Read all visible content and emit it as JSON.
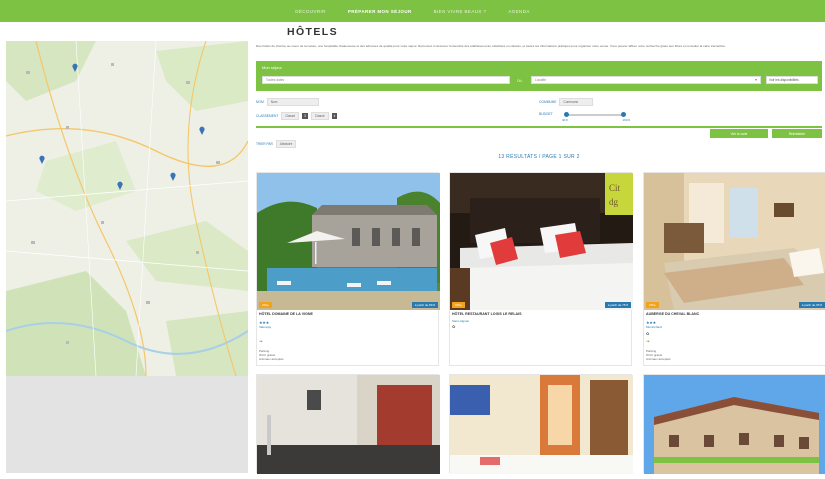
{
  "nav": {
    "items": [
      {
        "label": "DÉCOUVRIR",
        "active": false
      },
      {
        "label": "PRÉPARER MON SÉJOUR",
        "active": true
      },
      {
        "label": "BIEN VIVRE BEAUX ?",
        "active": false
      },
      {
        "label": "AGENDA",
        "active": false
      }
    ]
  },
  "page": {
    "title": "HÔTELS",
    "intro": "Des hôtels de charme au coeur de la nature, une hospitalité chaleureuse et des adresses de qualité pour votre séjour. Retrouvez ci-dessous l'ensemble des établissements, labellisés ou classés, et toutes les informations pratiques pour organiser votre venue. Vous pouvez affiner votre recherche grâce aux filtres et consulter la carte interactive."
  },
  "search": {
    "label": "Mon séjour",
    "input_value": "Toutes dates",
    "select_label": "Où",
    "select_value": "Localité",
    "button_label": "Voir les disponibilités"
  },
  "filters": {
    "nom_label": "NOM",
    "nom_value": "Nom",
    "classement_label": "CLASSEMENT",
    "classement_a": "Classé",
    "classement_a_count": "3",
    "classement_b": "Classé",
    "classement_b_count": "4",
    "commune_label": "COMMUNE",
    "commune_value": "Commune",
    "budget_label": "BUDGET",
    "budget_min": "40 €",
    "budget_max": "190 €",
    "reset_label": "Réinitialiser",
    "map_label": "Voir la carte",
    "tri_label": "TRIER PAR",
    "tri_value": "Aléatoire"
  },
  "results": {
    "text": "13 RÉSULTATS / PAGE 1 SUR 2"
  },
  "hotels": [
    {
      "name": "HÔTEL DOMAINE DE LA VIGNE",
      "stars": "★★★",
      "town": "Valençay",
      "tag": "Offre",
      "price": "à partir de 89 €",
      "extra1": "Parking",
      "extra2": "Wi-Fi gratuit",
      "extra3": "Animaux acceptés"
    },
    {
      "name": "HÔTEL RESTAURANT LOGIS LE RELAIS",
      "stars": "",
      "town": "Saint-Aignan",
      "tag": "Offre",
      "price": "à partir de 75 €",
      "extra1": "",
      "extra2": "",
      "extra3": ""
    },
    {
      "name": "AUBERGE DU CHEVAL BLANC",
      "stars": "★★★",
      "town": "Montrichard",
      "tag": "Offre",
      "price": "à partir de 95 €",
      "extra1": "Parking",
      "extra2": "Wi-Fi gratuit",
      "extra3": "Animaux acceptés"
    },
    {
      "name": "",
      "stars": "",
      "town": "",
      "tag": "",
      "price": "",
      "extra1": "",
      "extra2": "",
      "extra3": ""
    },
    {
      "name": "",
      "stars": "",
      "town": "",
      "tag": "",
      "price": "",
      "extra1": "",
      "extra2": "",
      "extra3": ""
    },
    {
      "name": "",
      "stars": "",
      "town": "",
      "tag": "",
      "price": "",
      "extra1": "",
      "extra2": "",
      "extra3": ""
    }
  ],
  "colors": {
    "brand": "#7dc243",
    "link": "#2a7ab0",
    "badge": "#f0a31b"
  }
}
